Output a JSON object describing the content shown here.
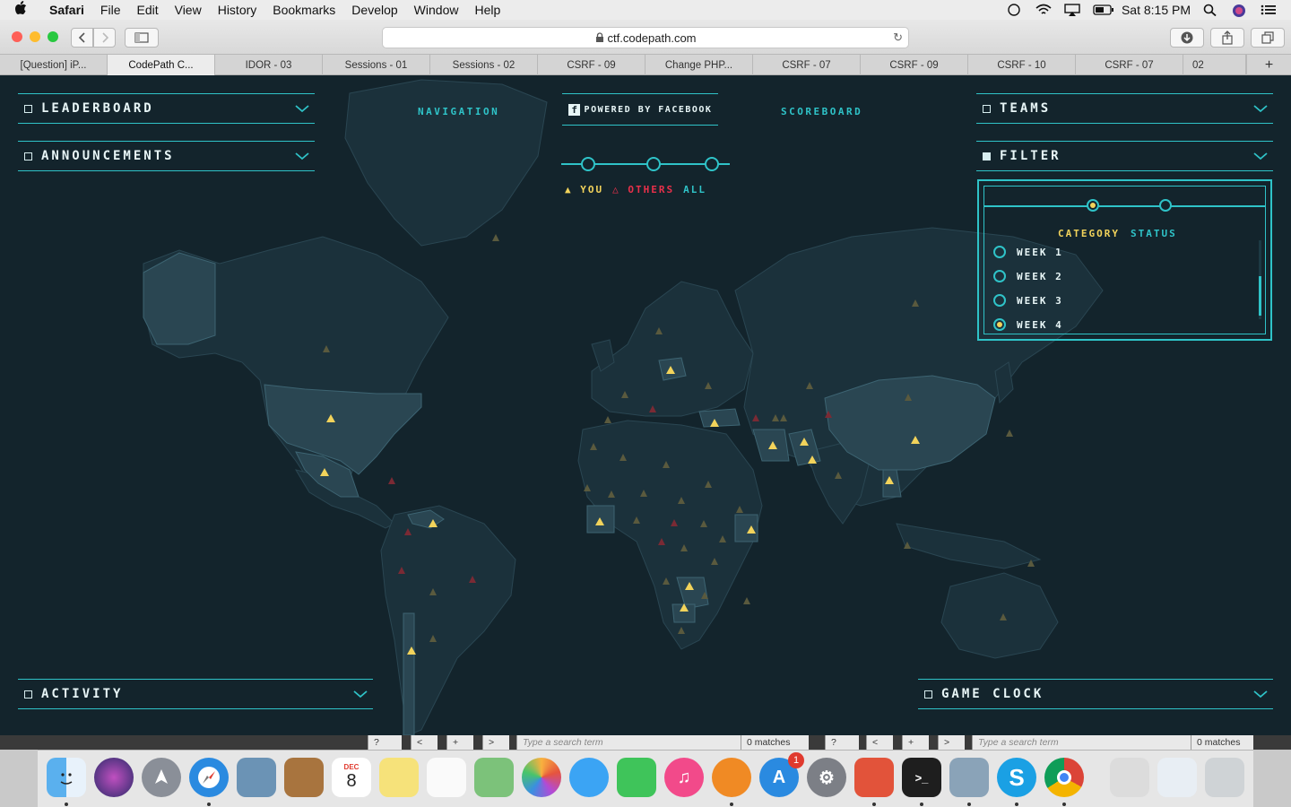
{
  "menubar": {
    "app_name": "Safari",
    "items": [
      "File",
      "Edit",
      "View",
      "History",
      "Bookmarks",
      "Develop",
      "Window",
      "Help"
    ],
    "clock": "Sat 8:15 PM"
  },
  "toolbar": {
    "url": "ctf.codepath.com"
  },
  "tabs": [
    "[Question] iP...",
    "CodePath C...",
    "IDOR - 03",
    "Sessions - 01",
    "Sessions - 02",
    "CSRF - 09",
    "Change PHP...",
    "CSRF - 07",
    "CSRF - 09",
    "CSRF - 10",
    "CSRF - 07",
    "02"
  ],
  "active_tab_index": 1,
  "page": {
    "leaderboard": "LEADERBOARD",
    "announcements": "ANNOUNCEMENTS",
    "activity": "ACTIVITY",
    "navigation": "NAVIGATION",
    "powered_by": "POWERED BY FACEBOOK",
    "scoreboard": "SCOREBOARD",
    "teams": "TEAMS",
    "filter": "FILTER",
    "game_clock": "GAME CLOCK",
    "legend": {
      "you": "YOU",
      "others": "OTHERS",
      "all": "ALL"
    },
    "filter_tabs": {
      "category": "CATEGORY",
      "status": "STATUS"
    },
    "filter_options": [
      {
        "label": "WEEK 1",
        "selected": false
      },
      {
        "label": "WEEK 2",
        "selected": false
      },
      {
        "label": "WEEK 3",
        "selected": false
      },
      {
        "label": "WEEK 4",
        "selected": true
      }
    ]
  },
  "findbar": {
    "placeholder": "Type a search term",
    "matches": "0 matches"
  },
  "dock": {
    "calendar_month": "DEC",
    "calendar_day": "8",
    "appstore_badge": "1"
  },
  "colors": {
    "accent": "#2fc3c8",
    "you": "#f2d35b",
    "others": "#e8304a",
    "background": "#13242c"
  }
}
